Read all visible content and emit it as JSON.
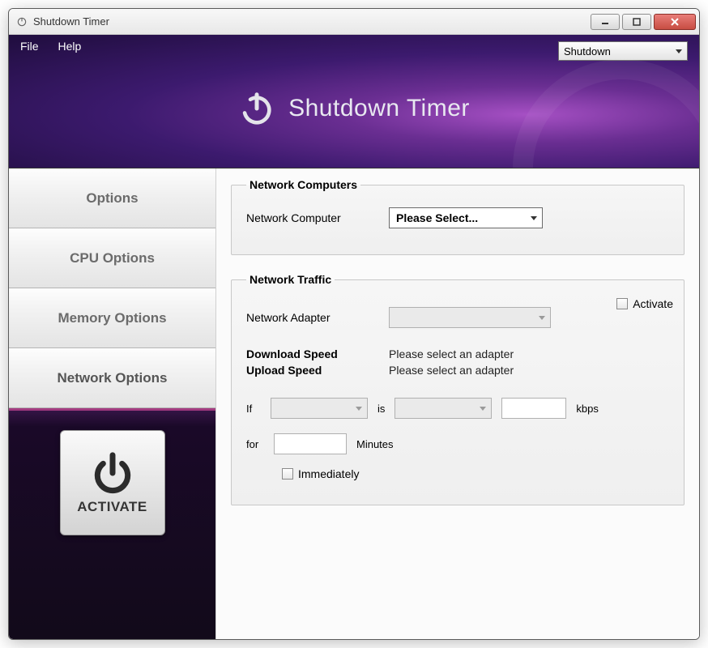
{
  "window": {
    "title": "Shutdown Timer"
  },
  "menu": {
    "file": "File",
    "help": "Help"
  },
  "action_select": {
    "value": "Shutdown"
  },
  "banner": {
    "title": "Shutdown Timer"
  },
  "sidebar": {
    "tabs": [
      {
        "label": "Options"
      },
      {
        "label": "CPU Options"
      },
      {
        "label": "Memory Options"
      },
      {
        "label": "Network Options"
      }
    ],
    "activate": "ACTIVATE"
  },
  "panel_computers": {
    "legend": "Network Computers",
    "label": "Network Computer",
    "select_value": "Please Select..."
  },
  "panel_traffic": {
    "legend": "Network Traffic",
    "activate_label": "Activate",
    "adapter_label": "Network Adapter",
    "adapter_value": "",
    "download_label": "Download Speed",
    "download_value": "Please select an adapter",
    "upload_label": "Upload Speed",
    "upload_value": "Please select an adapter",
    "if_label": "If",
    "is_label": "is",
    "kbps_label": "kbps",
    "for_label": "for",
    "minutes_label": "Minutes",
    "immediately_label": "Immediately"
  }
}
